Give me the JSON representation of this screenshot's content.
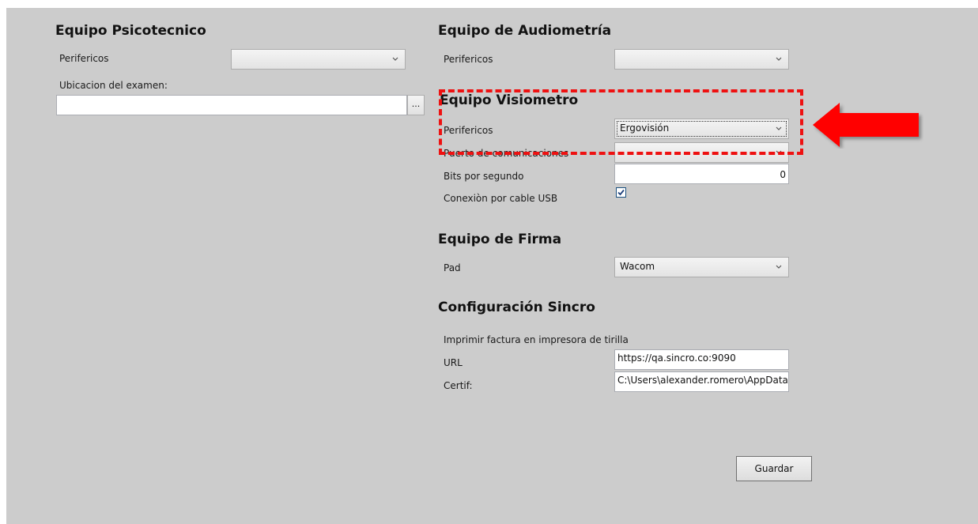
{
  "psicotecnico": {
    "title": "Equipo Psicotecnico",
    "perifericos_label": "Perifericos",
    "perifericos_value": "",
    "ubicacion_label": "Ubicacion del examen:",
    "ubicacion_value": "",
    "browse_label": "..."
  },
  "audiometria": {
    "title": "Equipo de Audiometría",
    "perifericos_label": "Perifericos",
    "perifericos_value": ""
  },
  "visiometro": {
    "title": "Equipo Visiometro",
    "perifericos_label": "Perifericos",
    "perifericos_value": "Ergovisión",
    "puerto_label": "Puerto de comunicaciones",
    "puerto_value": "",
    "bits_label": "Bits por segundo",
    "bits_value": "0",
    "usb_label": "Conexiòn por cable USB",
    "usb_checked": true
  },
  "firma": {
    "title": "Equipo de Firma",
    "pad_label": "Pad",
    "pad_value": "Wacom"
  },
  "sincro": {
    "title": "Configuración Sincro",
    "imprimir_label": "Imprimir factura en impresora de tirilla",
    "url_label": "URL",
    "url_value": "https://qa.sincro.co:9090",
    "certif_label": "Certif:",
    "certif_value": "C:\\Users\\alexander.romero\\AppData"
  },
  "actions": {
    "save_label": "Guardar"
  },
  "colors": {
    "panel_bg": "#cccccc",
    "highlight": "#ee1111"
  },
  "icons": {
    "combo_chevron": "chevron-down-icon",
    "checkbox_mark": "checkmark-icon",
    "annotation": "red-arrow-icon"
  }
}
